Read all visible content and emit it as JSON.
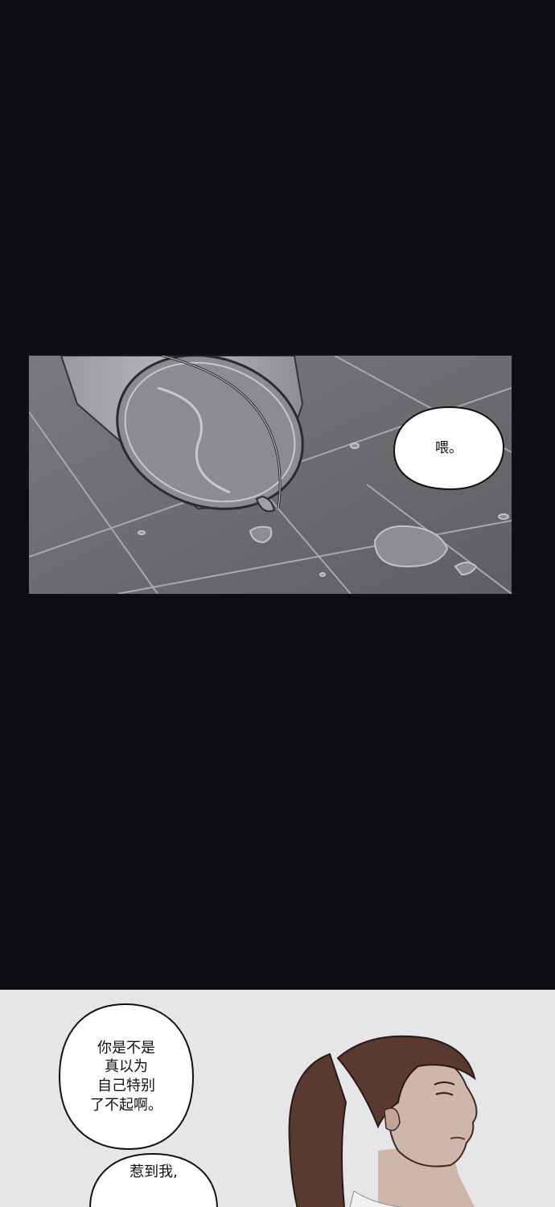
{
  "panels": [
    {
      "id": "bucket-panel",
      "bubbles": [
        {
          "text": "喂。"
        }
      ]
    },
    {
      "id": "girl-panel",
      "bubbles": [
        {
          "lines": [
            "你是不是",
            "真以为",
            "自己特别",
            "了不起啊。"
          ]
        },
        {
          "lines": [
            "惹到我,"
          ]
        }
      ]
    }
  ],
  "colors": {
    "page_background": "#0d0c12",
    "floor": "#6f6f73",
    "grout": "#a9a9ad",
    "girl_panel_background": "#e6e6e8",
    "hair": "#5a3a30",
    "skin": "#cfb6ab"
  }
}
